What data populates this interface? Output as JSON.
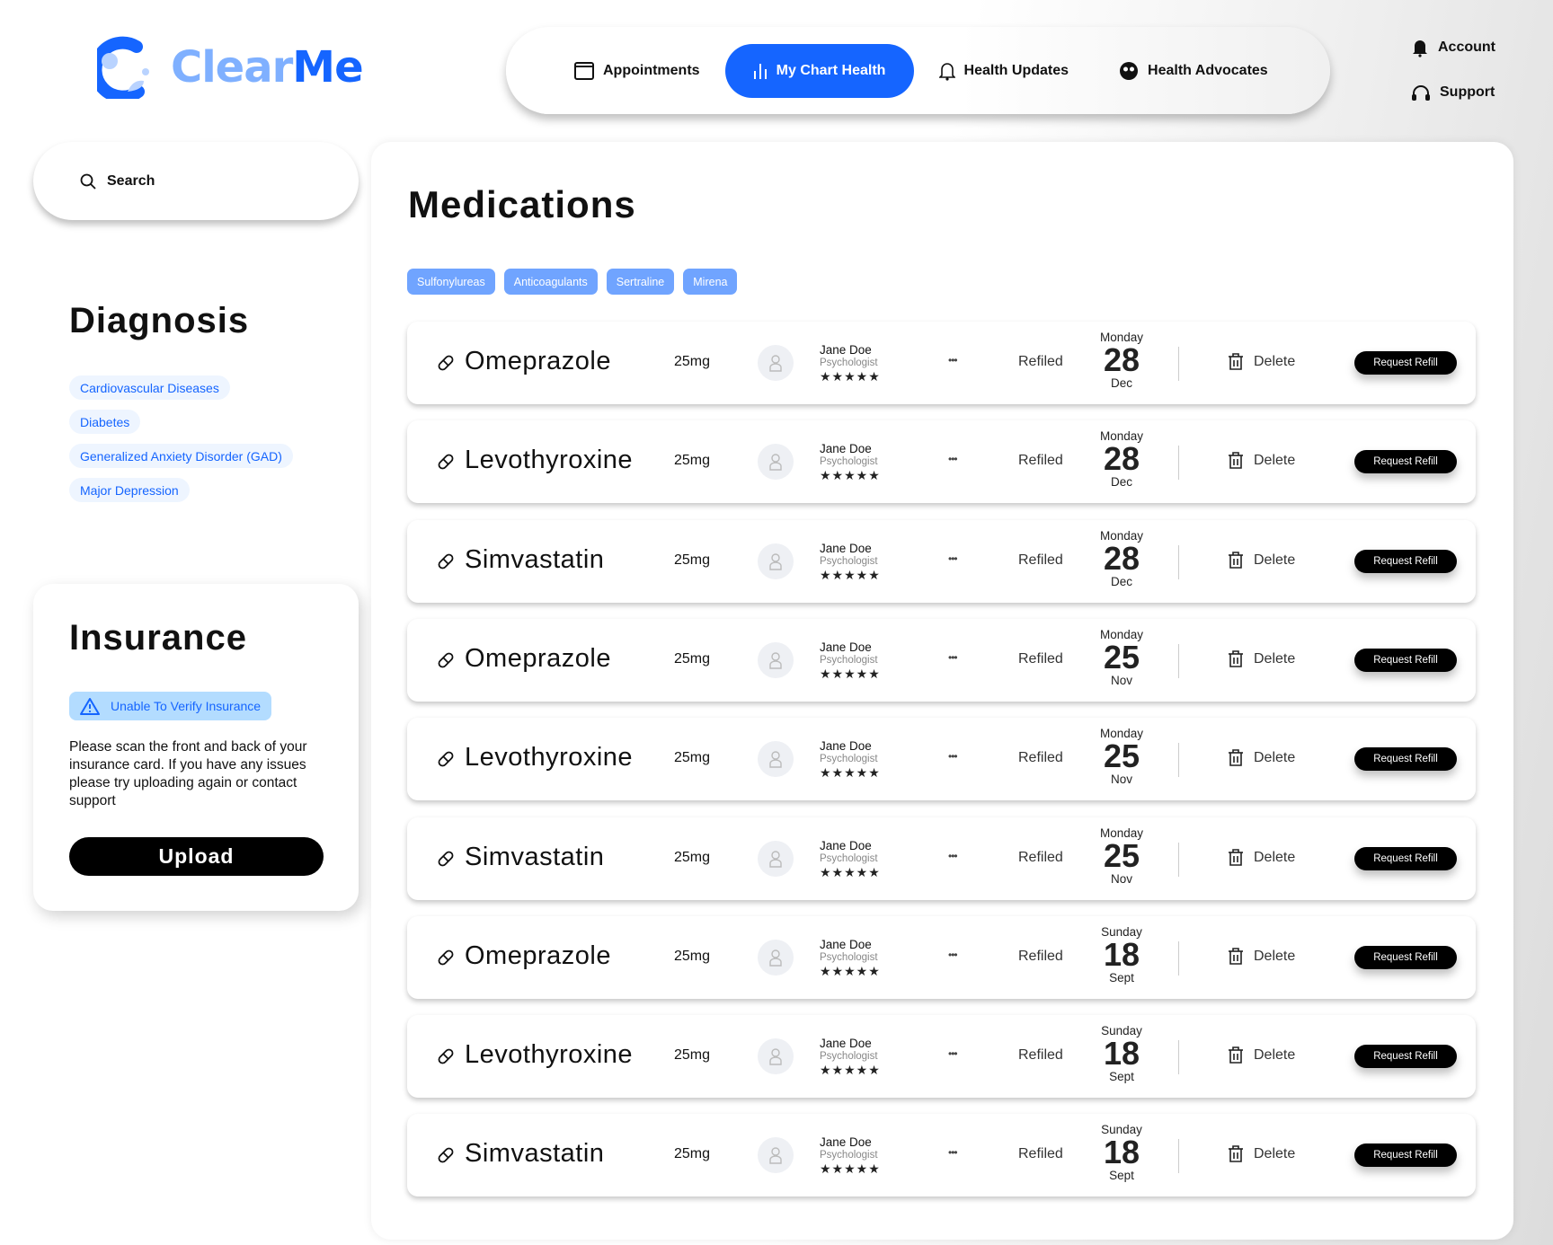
{
  "brand": {
    "name_part1": "Clear",
    "name_part2": "Me",
    "color_primary": "#1565ff",
    "color_light": "#7fb0ff"
  },
  "nav": {
    "items": [
      {
        "label": "Appointments",
        "icon": "calendar-icon",
        "active": false
      },
      {
        "label": "My Chart Health",
        "icon": "bar-chart-icon",
        "active": true
      },
      {
        "label": "Health Updates",
        "icon": "bell-icon",
        "active": false
      },
      {
        "label": "Health Advocates",
        "icon": "people-icon",
        "active": false
      }
    ]
  },
  "top_links": {
    "account": "Account",
    "support": "Support"
  },
  "search": {
    "label": "Search"
  },
  "diagnosis": {
    "title": "Diagnosis",
    "items": [
      "Cardiovascular Diseases",
      "Diabetes",
      "Generalized Anxiety Disorder (GAD)",
      "Major Depression"
    ]
  },
  "insurance": {
    "title": "Insurance",
    "badge": "Unable To Verify Insurance",
    "text": "Please scan the front and back of your insurance card. If you have any issues please try uploading again or contact support",
    "upload_label": "Upload"
  },
  "medications": {
    "title": "Medications",
    "tags": [
      "Sulfonylureas",
      "Anticoagulants",
      "Sertraline",
      "Mirena"
    ],
    "delete_label": "Delete",
    "refill_label": "Request Refill",
    "more_label": "•••",
    "rows": [
      {
        "name": "Omeprazole",
        "dose": "25mg",
        "doctor": "Jane Doe",
        "role": "Psychologist",
        "rating": 5,
        "status": "Refiled",
        "weekday": "Monday",
        "day": "28",
        "month": "Dec"
      },
      {
        "name": "Levothyroxine",
        "dose": "25mg",
        "doctor": "Jane Doe",
        "role": "Psychologist",
        "rating": 5,
        "status": "Refiled",
        "weekday": "Monday",
        "day": "28",
        "month": "Dec"
      },
      {
        "name": "Simvastatin",
        "dose": "25mg",
        "doctor": "Jane Doe",
        "role": "Psychologist",
        "rating": 5,
        "status": "Refiled",
        "weekday": "Monday",
        "day": "28",
        "month": "Dec"
      },
      {
        "name": "Omeprazole",
        "dose": "25mg",
        "doctor": "Jane Doe",
        "role": "Psychologist",
        "rating": 5,
        "status": "Refiled",
        "weekday": "Monday",
        "day": "25",
        "month": "Nov"
      },
      {
        "name": "Levothyroxine",
        "dose": "25mg",
        "doctor": "Jane Doe",
        "role": "Psychologist",
        "rating": 5,
        "status": "Refiled",
        "weekday": "Monday",
        "day": "25",
        "month": "Nov"
      },
      {
        "name": "Simvastatin",
        "dose": "25mg",
        "doctor": "Jane Doe",
        "role": "Psychologist",
        "rating": 5,
        "status": "Refiled",
        "weekday": "Monday",
        "day": "25",
        "month": "Nov"
      },
      {
        "name": "Omeprazole",
        "dose": "25mg",
        "doctor": "Jane Doe",
        "role": "Psychologist",
        "rating": 5,
        "status": "Refiled",
        "weekday": "Sunday",
        "day": "18",
        "month": "Sept"
      },
      {
        "name": "Levothyroxine",
        "dose": "25mg",
        "doctor": "Jane Doe",
        "role": "Psychologist",
        "rating": 5,
        "status": "Refiled",
        "weekday": "Sunday",
        "day": "18",
        "month": "Sept"
      },
      {
        "name": "Simvastatin",
        "dose": "25mg",
        "doctor": "Jane Doe",
        "role": "Psychologist",
        "rating": 5,
        "status": "Refiled",
        "weekday": "Sunday",
        "day": "18",
        "month": "Sept"
      }
    ]
  }
}
